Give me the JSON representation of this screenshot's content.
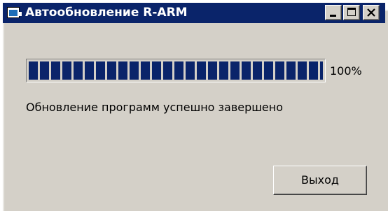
{
  "window": {
    "title": "Автообновление R-ARM",
    "title_bar_color": "#0a246a",
    "background_color": "#d4d0c8",
    "icons": {
      "app": "app-window-icon",
      "minimize": "minimize-icon",
      "maximize": "maximize-icon",
      "close": "close-icon"
    }
  },
  "progress": {
    "percent_label": "100%",
    "value": 1.0,
    "fill_color": "#0a246a"
  },
  "status": {
    "message": "Обновление программ успешно завершено"
  },
  "actions": {
    "exit_label": "Выход"
  }
}
